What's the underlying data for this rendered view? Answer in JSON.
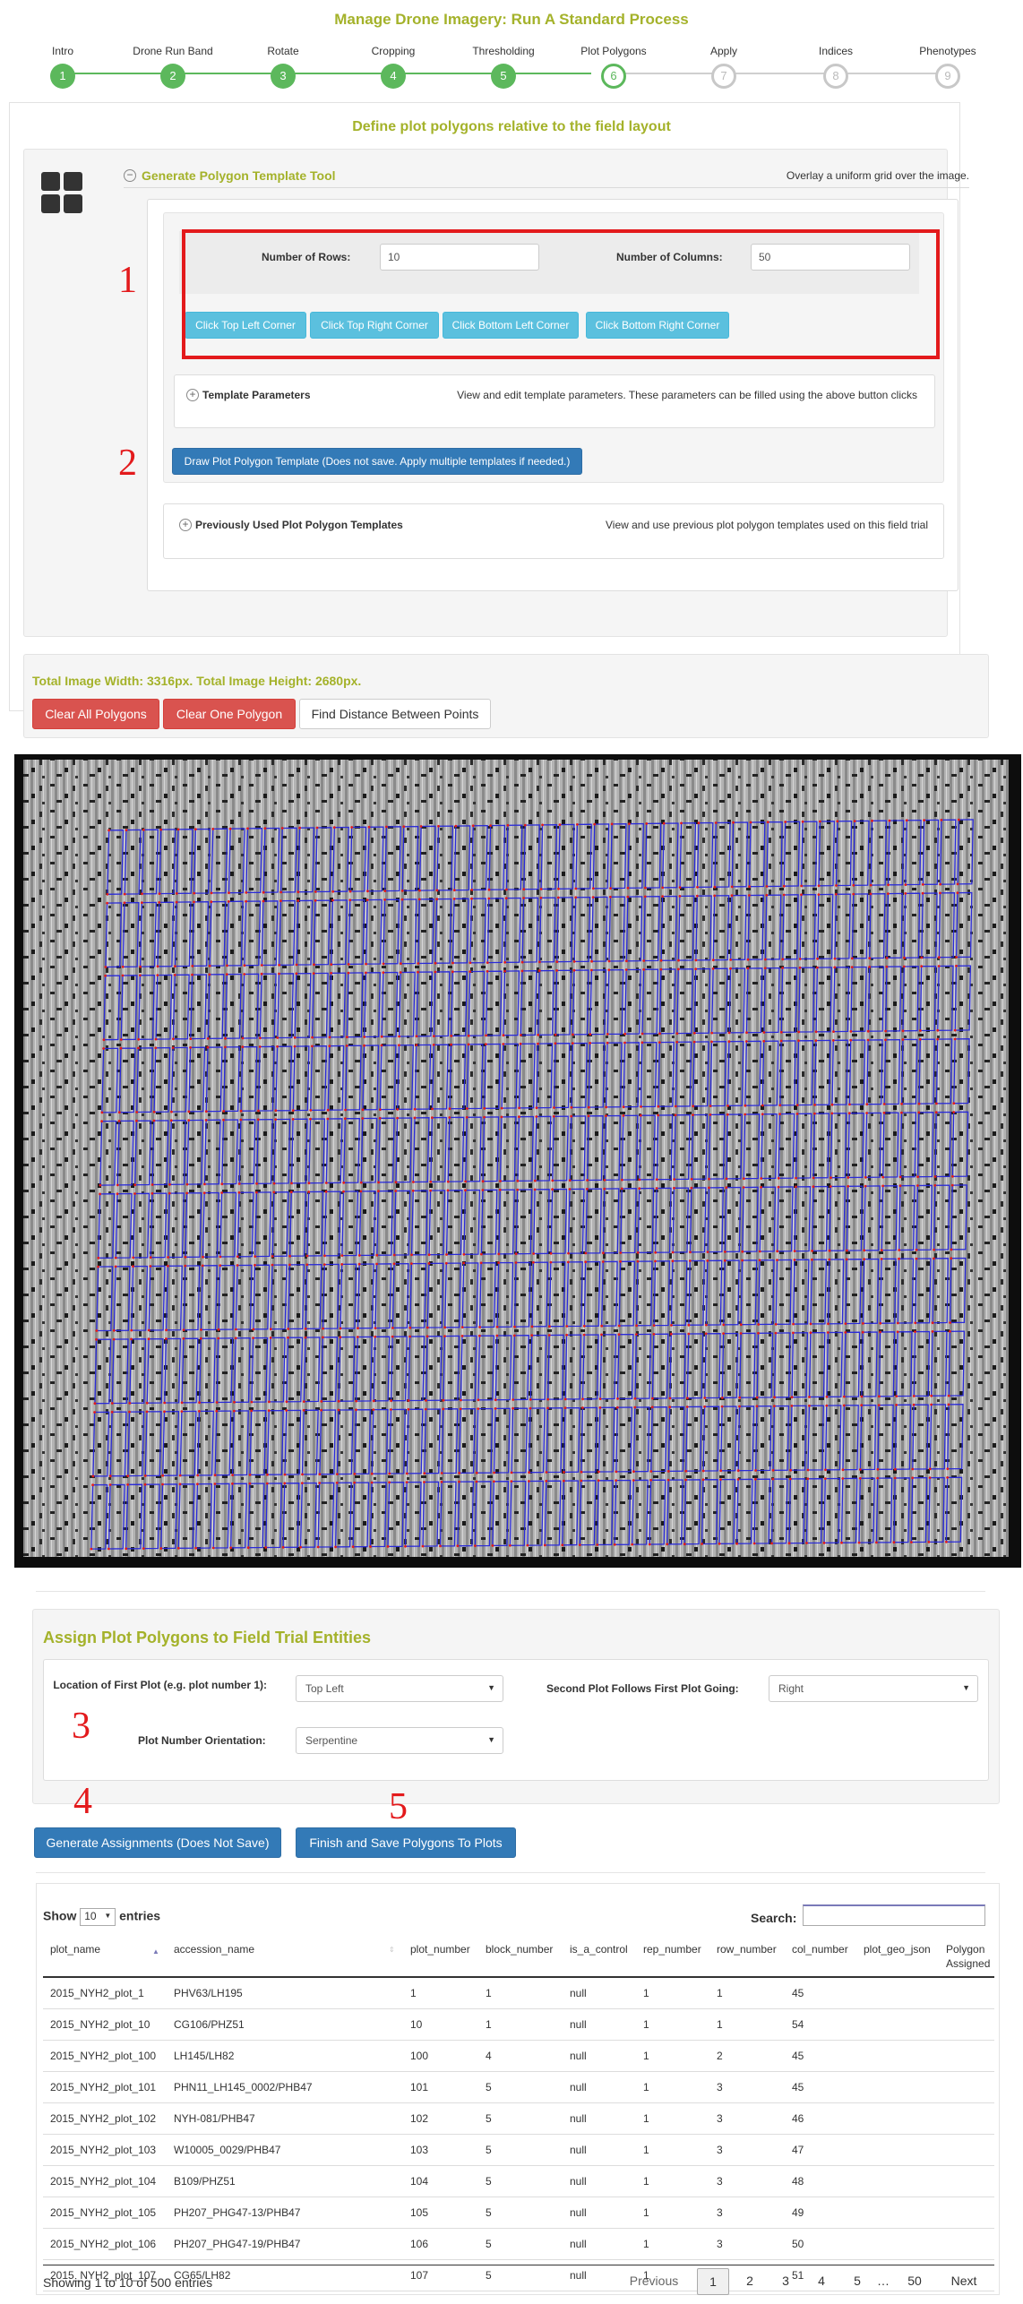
{
  "page_title": "Manage Drone Imagery: Run A Standard Process",
  "steps": [
    {
      "label": "Intro",
      "num": "1",
      "state": "done"
    },
    {
      "label": "Drone Run Band",
      "num": "2",
      "state": "done"
    },
    {
      "label": "Rotate",
      "num": "3",
      "state": "done"
    },
    {
      "label": "Cropping",
      "num": "4",
      "state": "done"
    },
    {
      "label": "Thresholding",
      "num": "5",
      "state": "done"
    },
    {
      "label": "Plot Polygons",
      "num": "6",
      "state": "current"
    },
    {
      "label": "Apply",
      "num": "7",
      "state": "todo"
    },
    {
      "label": "Indices",
      "num": "8",
      "state": "todo"
    },
    {
      "label": "Phenotypes",
      "num": "9",
      "state": "todo"
    }
  ],
  "section_title": "Define plot polygons relative to the field layout",
  "tool": {
    "title": "Generate Polygon Template Tool",
    "description": "Overlay a uniform grid over the image.",
    "rows_label": "Number of Rows:",
    "rows_value": "10",
    "cols_label": "Number of Columns:",
    "cols_value": "50",
    "corner_buttons": [
      "Click Top Left Corner",
      "Click Top Right Corner",
      "Click Bottom Left Corner",
      "Click Bottom Right Corner"
    ],
    "template_params_title": "Template Parameters",
    "template_params_desc": "View and edit template parameters. These parameters can be filled using the above button clicks",
    "draw_button": "Draw Plot Polygon Template (Does not save. Apply multiple templates if needed.)",
    "prev_title": "Previously Used Plot Polygon Templates",
    "prev_desc": "View and use previous plot polygon templates used on this field trial"
  },
  "annotations": [
    "1",
    "2",
    "3",
    "4",
    "5"
  ],
  "dims_text": "Total Image Width: 3316px. Total Image Height: 2680px.",
  "image_buttons": {
    "clear_all": "Clear All Polygons",
    "clear_one": "Clear One Polygon",
    "find_distance": "Find Distance Between Points"
  },
  "drone_image": {
    "grid_rows": 10,
    "grid_cols": 50,
    "polygon_color": "#2a2ad8",
    "point_color": "#e31a1c"
  },
  "assign": {
    "title": "Assign Plot Polygons to Field Trial Entities",
    "first_plot_label": "Location of First Plot (e.g. plot number 1):",
    "first_plot_value": "Top Left",
    "second_plot_label": "Second Plot Follows First Plot Going:",
    "second_plot_value": "Right",
    "orientation_label": "Plot Number Orientation:",
    "orientation_value": "Serpentine",
    "generate_button": "Generate Assignments (Does Not Save)",
    "finish_button": "Finish and Save Polygons To Plots"
  },
  "table": {
    "show_prefix": "Show",
    "show_value": "10",
    "show_suffix": "entries",
    "search_label": "Search:",
    "columns": [
      "plot_name",
      "accession_name",
      "plot_number",
      "block_number",
      "is_a_control",
      "rep_number",
      "row_number",
      "col_number",
      "plot_geo_json",
      "Polygon Assigned"
    ],
    "rows": [
      [
        "2015_NYH2_plot_1",
        "PHV63/LH195",
        "1",
        "1",
        "null",
        "1",
        "1",
        "45"
      ],
      [
        "2015_NYH2_plot_10",
        "CG106/PHZ51",
        "10",
        "1",
        "null",
        "1",
        "1",
        "54"
      ],
      [
        "2015_NYH2_plot_100",
        "LH145/LH82",
        "100",
        "4",
        "null",
        "1",
        "2",
        "45"
      ],
      [
        "2015_NYH2_plot_101",
        "PHN11_LH145_0002/PHB47",
        "101",
        "5",
        "null",
        "1",
        "3",
        "45"
      ],
      [
        "2015_NYH2_plot_102",
        "NYH-081/PHB47",
        "102",
        "5",
        "null",
        "1",
        "3",
        "46"
      ],
      [
        "2015_NYH2_plot_103",
        "W10005_0029/PHB47",
        "103",
        "5",
        "null",
        "1",
        "3",
        "47"
      ],
      [
        "2015_NYH2_plot_104",
        "B109/PHZ51",
        "104",
        "5",
        "null",
        "1",
        "3",
        "48"
      ],
      [
        "2015_NYH2_plot_105",
        "PH207_PHG47-13/PHB47",
        "105",
        "5",
        "null",
        "1",
        "3",
        "49"
      ],
      [
        "2015_NYH2_plot_106",
        "PH207_PHG47-19/PHB47",
        "106",
        "5",
        "null",
        "1",
        "3",
        "50"
      ],
      [
        "2015_NYH2_plot_107",
        "CG65/LH82",
        "107",
        "5",
        "null",
        "1",
        "3",
        "51"
      ]
    ],
    "showing_text": "Showing 1 to 10 of 500 entries",
    "pagination": [
      "Previous",
      "1",
      "2",
      "3",
      "4",
      "5",
      "…",
      "50",
      "Next"
    ]
  },
  "colors": {
    "accent": "#a4b22a",
    "success": "#5cb85c",
    "info": "#5bc0de",
    "primary": "#337ab7",
    "danger": "#d9534f",
    "annotation": "#e31a1c"
  }
}
